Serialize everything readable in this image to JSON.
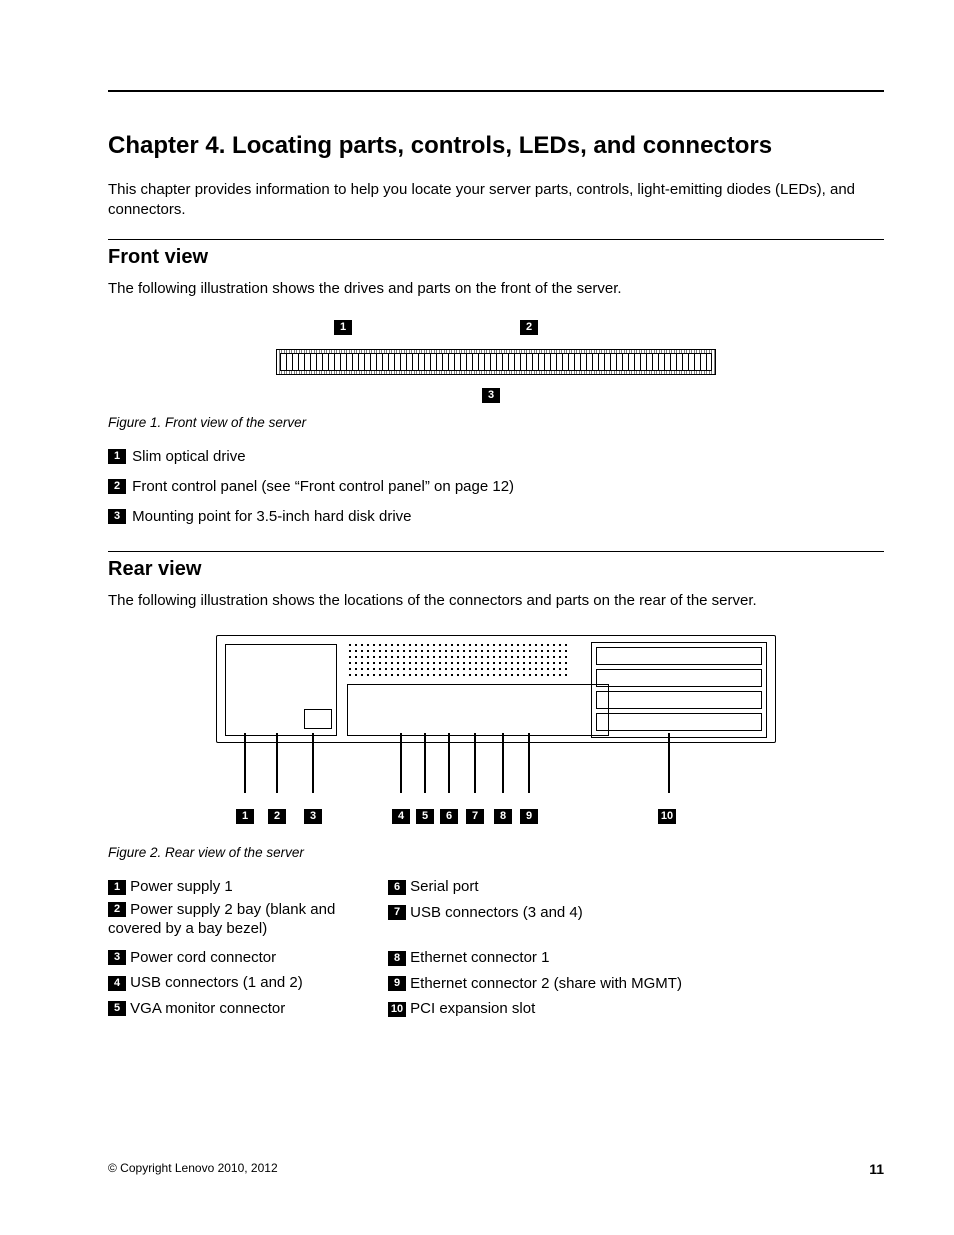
{
  "chapter": {
    "title": "Chapter 4.   Locating parts, controls, LEDs, and connectors",
    "intro": "This chapter provides information to help you locate your server parts, controls, light-emitting diodes (LEDs), and connectors."
  },
  "front_view": {
    "heading": "Front view",
    "body": "The following illustration shows the drives and parts on the front of the server.",
    "figure_caption": "Figure 1.  Front view of the server",
    "callouts": [
      {
        "num": "1",
        "text": "Slim optical drive"
      },
      {
        "num": "2",
        "text": "Front control panel (see “Front control panel” on page 12)"
      },
      {
        "num": "3",
        "text": "Mounting point for 3.5-inch hard disk drive"
      }
    ]
  },
  "rear_view": {
    "heading": "Rear view",
    "body": "The following illustration shows the locations of the connectors and parts on the rear of the server.",
    "figure_caption": "Figure 2.  Rear view of the server",
    "callouts_left": [
      {
        "num": "1",
        "text": "Power supply 1"
      },
      {
        "num": "2",
        "text": "Power supply 2 bay (blank and",
        "cont": "covered by a bay bezel)"
      },
      {
        "num": "3",
        "text": "Power cord connector"
      },
      {
        "num": "4",
        "text": "USB connectors (1 and 2)"
      },
      {
        "num": "5",
        "text": "VGA monitor connector"
      }
    ],
    "callouts_right": [
      {
        "num": "6",
        "text": "Serial port"
      },
      {
        "num": "7",
        "text": "USB connectors (3 and 4)"
      },
      {
        "num": "8",
        "text": "Ethernet connector 1"
      },
      {
        "num": "9",
        "text": "Ethernet connector 2 (share with MGMT)"
      },
      {
        "num": "10",
        "text": "PCI expansion slot"
      }
    ]
  },
  "footer": {
    "copyright": "© Copyright Lenovo 2010, 2012",
    "page": "11"
  }
}
